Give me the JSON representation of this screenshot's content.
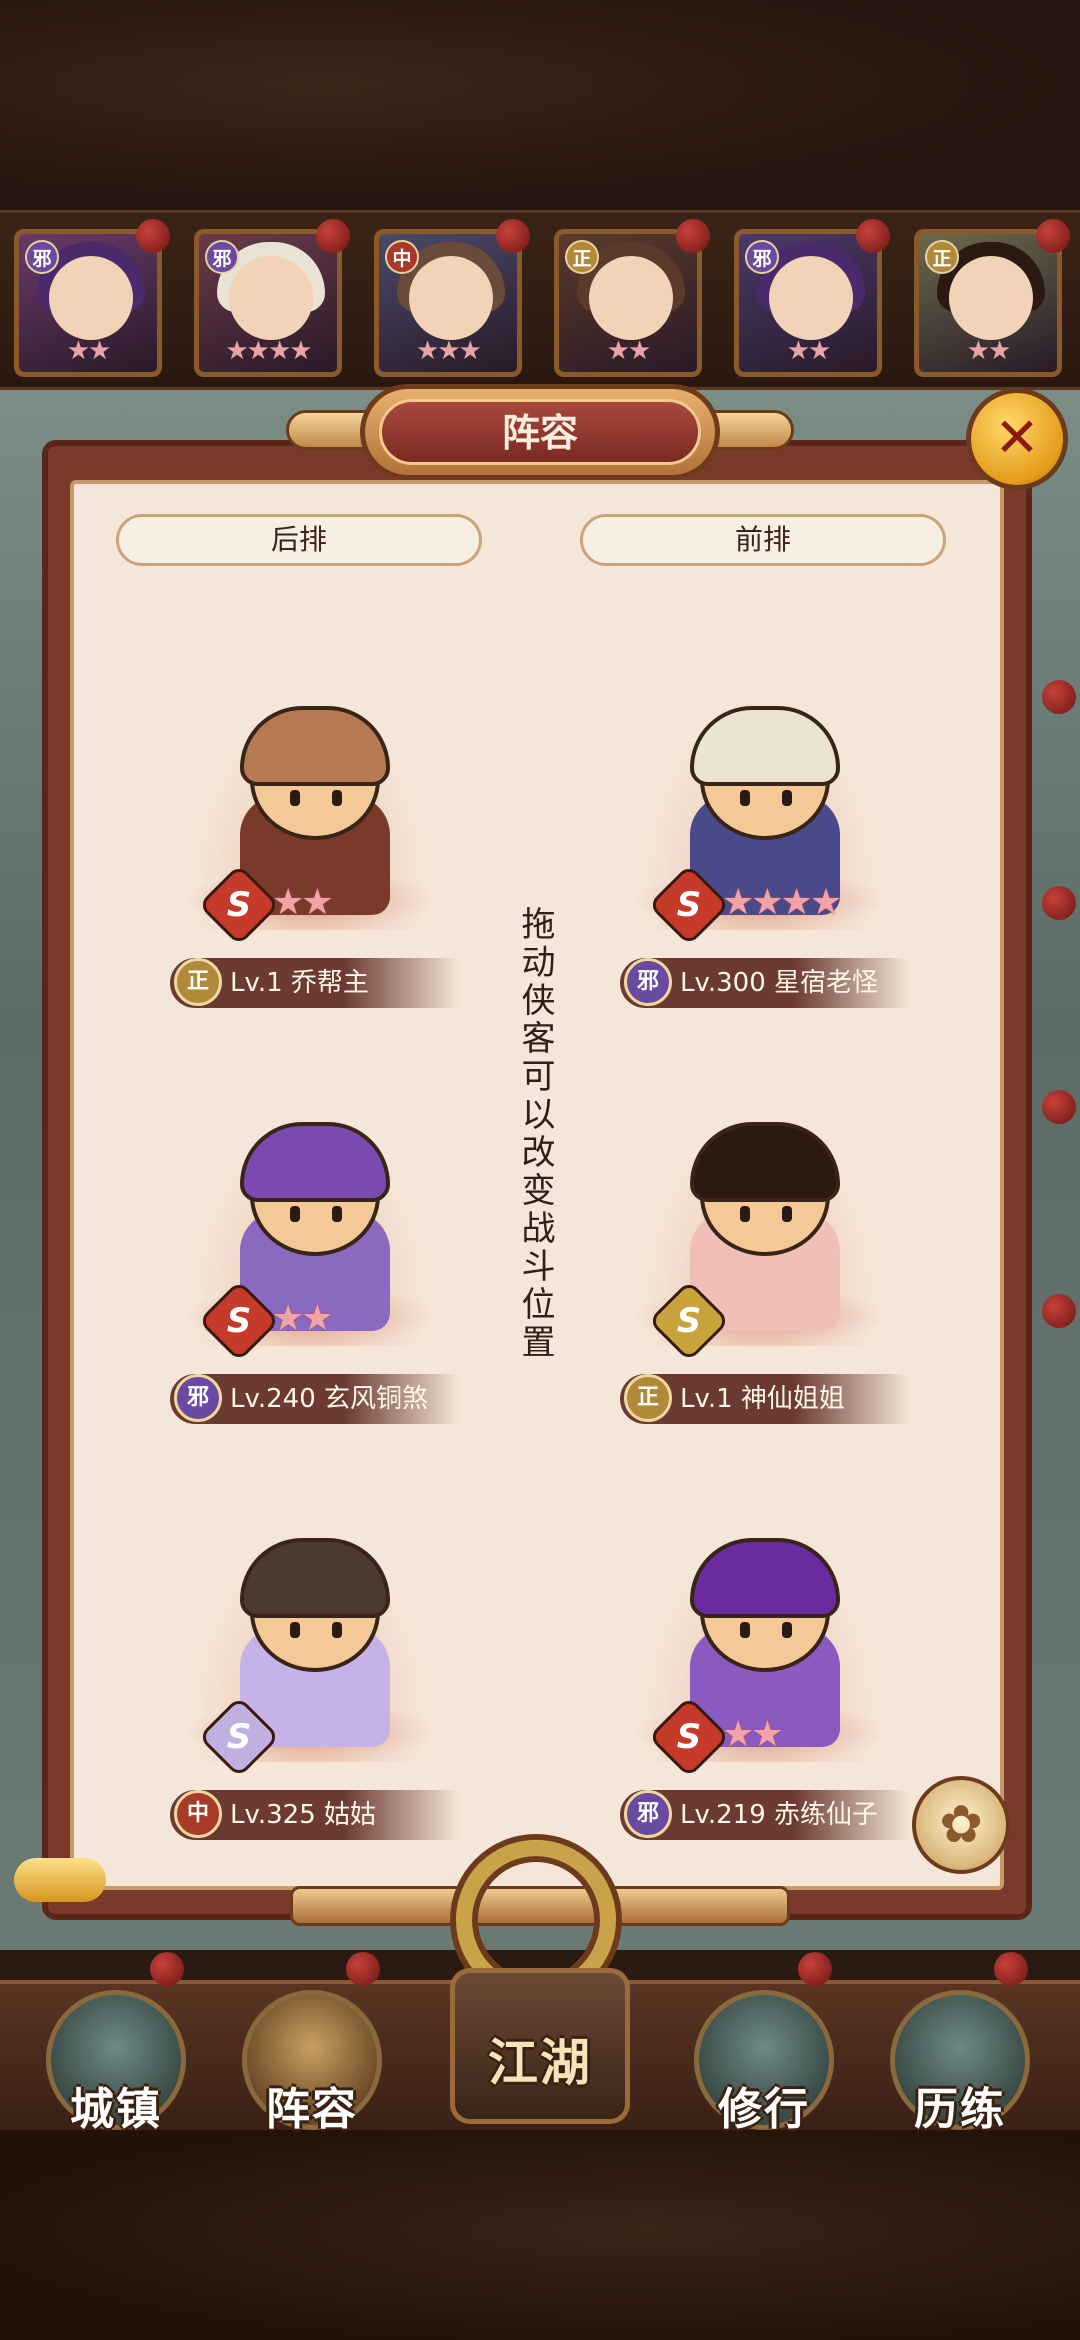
{
  "panel": {
    "title": "阵容",
    "back_row_label": "后排",
    "front_row_label": "前排",
    "hint": "拖动侠客可以改变战斗位置",
    "close_icon": "close-icon",
    "settings_icon": "settings-icon"
  },
  "strip": [
    {
      "faction": "邪",
      "stars": "★★",
      "faction_color": "#6a4aa0",
      "hair": "#4a2a6a",
      "bg": "#6a3a6a"
    },
    {
      "faction": "邪",
      "stars": "★★★★",
      "faction_color": "#6a4aa0",
      "hair": "#e9e3d6",
      "bg": "#6a3a4a"
    },
    {
      "faction": "中",
      "stars": "★★★",
      "faction_color": "#a83a2a",
      "hair": "#6a4a3a",
      "bg": "#4a4a6a"
    },
    {
      "faction": "正",
      "stars": "★★",
      "faction_color": "#b08a3a",
      "hair": "#5a3a2a",
      "bg": "#5a3a2a"
    },
    {
      "faction": "邪",
      "stars": "★★",
      "faction_color": "#6a4aa0",
      "hair": "#4a2a6a",
      "bg": "#4a3a6a"
    },
    {
      "faction": "正",
      "stars": "★★",
      "faction_color": "#b08a3a",
      "hair": "#2a1a12",
      "bg": "#6a6a4a"
    }
  ],
  "heroes": [
    {
      "faction": "正",
      "name": "Lv.1 乔帮主",
      "stars": "★★",
      "rank": "S",
      "faction_color": "#b08a3a",
      "rank_color": "#c63a2a",
      "hair": "#b67a52",
      "body": "#7a3a2a"
    },
    {
      "faction": "邪",
      "name": "Lv.300 星宿老怪",
      "stars": "★★★★",
      "rank": "S",
      "faction_color": "#6a4aa0",
      "rank_color": "#c63a2a",
      "hair": "#ece4d2",
      "body": "#4a4a8a"
    },
    {
      "faction": "邪",
      "name": "Lv.240 玄风铜煞",
      "stars": "★★",
      "rank": "S",
      "faction_color": "#6a4aa0",
      "rank_color": "#c63a2a",
      "hair": "#7a4ab0",
      "body": "#8a6ac0"
    },
    {
      "faction": "正",
      "name": "Lv.1 神仙姐姐",
      "stars": "",
      "rank": "S",
      "faction_color": "#b08a3a",
      "rank_color": "#c8a23a",
      "hair": "#2a1a12",
      "body": "#f0c0b8"
    },
    {
      "faction": "中",
      "name": "Lv.325 姑姑",
      "stars": "",
      "rank": "S",
      "faction_color": "#a83a2a",
      "rank_color": "#c0b0e0",
      "hair": "#4a3a32",
      "body": "#c6b2e6"
    },
    {
      "faction": "邪",
      "name": "Lv.219 赤练仙子",
      "stars": "★★",
      "rank": "S",
      "faction_color": "#6a4aa0",
      "rank_color": "#c63a2a",
      "hair": "#6a2aa0",
      "body": "#8a5ac0"
    }
  ],
  "nav": [
    {
      "label": "城镇",
      "active": false
    },
    {
      "label": "阵容",
      "active": true
    },
    {
      "label": "江湖",
      "active": false
    },
    {
      "label": "修行",
      "active": false
    },
    {
      "label": "历练",
      "active": false
    }
  ]
}
